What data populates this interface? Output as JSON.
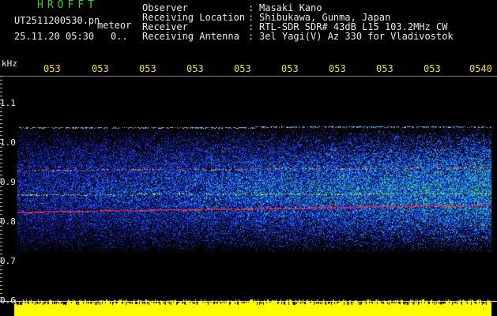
{
  "header": {
    "brand": "HROFFT",
    "filename": "UT2511200530.pn",
    "meteor_label": "meteor",
    "datetime": "25.11.20 05:30",
    "counter": "0.."
  },
  "info": [
    {
      "label": "Observer",
      "value": "Masaki Kano"
    },
    {
      "label": "Receiving Location",
      "value": "Shibukawa, Gunma, Japan"
    },
    {
      "label": "Receiver",
      "value": "RTL-SDR SDR# 43dB L15 103.2MHz CW"
    },
    {
      "label": "Receiving Antenna",
      "value": "3el Yagi(V) Az 330 for Vladivostok"
    }
  ],
  "axis": {
    "y_unit": "kHz",
    "y_ticks": [
      "1.1",
      "1.0",
      "0.9",
      "0.8",
      "0.7",
      "0.6"
    ],
    "x_ticks": [
      "053",
      "053",
      "053",
      "053",
      "053",
      "053",
      "053",
      "053",
      "053",
      "0540"
    ]
  },
  "colors": {
    "label_green": "#2bd42b",
    "text_white": "#e8e8e8",
    "tick_yellow": "#f0e000",
    "noise_floor_yellow": "#ffff00",
    "signal_red": "#ff2020"
  }
}
